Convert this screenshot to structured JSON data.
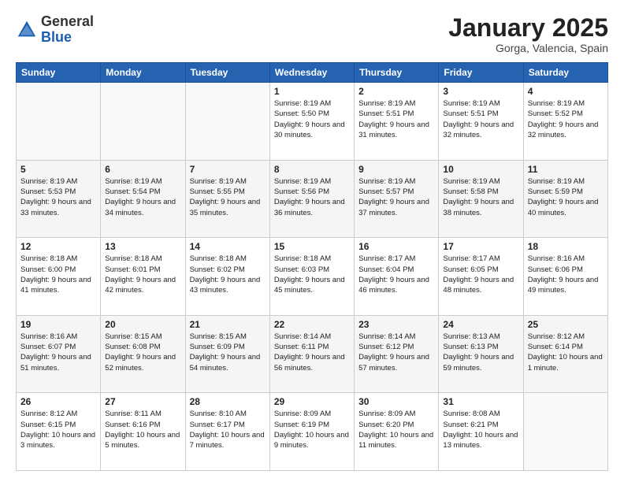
{
  "header": {
    "logo_general": "General",
    "logo_blue": "Blue",
    "month": "January 2025",
    "location": "Gorga, Valencia, Spain"
  },
  "weekdays": [
    "Sunday",
    "Monday",
    "Tuesday",
    "Wednesday",
    "Thursday",
    "Friday",
    "Saturday"
  ],
  "weeks": [
    [
      {
        "day": "",
        "info": ""
      },
      {
        "day": "",
        "info": ""
      },
      {
        "day": "",
        "info": ""
      },
      {
        "day": "1",
        "info": "Sunrise: 8:19 AM\nSunset: 5:50 PM\nDaylight: 9 hours\nand 30 minutes."
      },
      {
        "day": "2",
        "info": "Sunrise: 8:19 AM\nSunset: 5:51 PM\nDaylight: 9 hours\nand 31 minutes."
      },
      {
        "day": "3",
        "info": "Sunrise: 8:19 AM\nSunset: 5:51 PM\nDaylight: 9 hours\nand 32 minutes."
      },
      {
        "day": "4",
        "info": "Sunrise: 8:19 AM\nSunset: 5:52 PM\nDaylight: 9 hours\nand 32 minutes."
      }
    ],
    [
      {
        "day": "5",
        "info": "Sunrise: 8:19 AM\nSunset: 5:53 PM\nDaylight: 9 hours\nand 33 minutes."
      },
      {
        "day": "6",
        "info": "Sunrise: 8:19 AM\nSunset: 5:54 PM\nDaylight: 9 hours\nand 34 minutes."
      },
      {
        "day": "7",
        "info": "Sunrise: 8:19 AM\nSunset: 5:55 PM\nDaylight: 9 hours\nand 35 minutes."
      },
      {
        "day": "8",
        "info": "Sunrise: 8:19 AM\nSunset: 5:56 PM\nDaylight: 9 hours\nand 36 minutes."
      },
      {
        "day": "9",
        "info": "Sunrise: 8:19 AM\nSunset: 5:57 PM\nDaylight: 9 hours\nand 37 minutes."
      },
      {
        "day": "10",
        "info": "Sunrise: 8:19 AM\nSunset: 5:58 PM\nDaylight: 9 hours\nand 38 minutes."
      },
      {
        "day": "11",
        "info": "Sunrise: 8:19 AM\nSunset: 5:59 PM\nDaylight: 9 hours\nand 40 minutes."
      }
    ],
    [
      {
        "day": "12",
        "info": "Sunrise: 8:18 AM\nSunset: 6:00 PM\nDaylight: 9 hours\nand 41 minutes."
      },
      {
        "day": "13",
        "info": "Sunrise: 8:18 AM\nSunset: 6:01 PM\nDaylight: 9 hours\nand 42 minutes."
      },
      {
        "day": "14",
        "info": "Sunrise: 8:18 AM\nSunset: 6:02 PM\nDaylight: 9 hours\nand 43 minutes."
      },
      {
        "day": "15",
        "info": "Sunrise: 8:18 AM\nSunset: 6:03 PM\nDaylight: 9 hours\nand 45 minutes."
      },
      {
        "day": "16",
        "info": "Sunrise: 8:17 AM\nSunset: 6:04 PM\nDaylight: 9 hours\nand 46 minutes."
      },
      {
        "day": "17",
        "info": "Sunrise: 8:17 AM\nSunset: 6:05 PM\nDaylight: 9 hours\nand 48 minutes."
      },
      {
        "day": "18",
        "info": "Sunrise: 8:16 AM\nSunset: 6:06 PM\nDaylight: 9 hours\nand 49 minutes."
      }
    ],
    [
      {
        "day": "19",
        "info": "Sunrise: 8:16 AM\nSunset: 6:07 PM\nDaylight: 9 hours\nand 51 minutes."
      },
      {
        "day": "20",
        "info": "Sunrise: 8:15 AM\nSunset: 6:08 PM\nDaylight: 9 hours\nand 52 minutes."
      },
      {
        "day": "21",
        "info": "Sunrise: 8:15 AM\nSunset: 6:09 PM\nDaylight: 9 hours\nand 54 minutes."
      },
      {
        "day": "22",
        "info": "Sunrise: 8:14 AM\nSunset: 6:11 PM\nDaylight: 9 hours\nand 56 minutes."
      },
      {
        "day": "23",
        "info": "Sunrise: 8:14 AM\nSunset: 6:12 PM\nDaylight: 9 hours\nand 57 minutes."
      },
      {
        "day": "24",
        "info": "Sunrise: 8:13 AM\nSunset: 6:13 PM\nDaylight: 9 hours\nand 59 minutes."
      },
      {
        "day": "25",
        "info": "Sunrise: 8:12 AM\nSunset: 6:14 PM\nDaylight: 10 hours\nand 1 minute."
      }
    ],
    [
      {
        "day": "26",
        "info": "Sunrise: 8:12 AM\nSunset: 6:15 PM\nDaylight: 10 hours\nand 3 minutes."
      },
      {
        "day": "27",
        "info": "Sunrise: 8:11 AM\nSunset: 6:16 PM\nDaylight: 10 hours\nand 5 minutes."
      },
      {
        "day": "28",
        "info": "Sunrise: 8:10 AM\nSunset: 6:17 PM\nDaylight: 10 hours\nand 7 minutes."
      },
      {
        "day": "29",
        "info": "Sunrise: 8:09 AM\nSunset: 6:19 PM\nDaylight: 10 hours\nand 9 minutes."
      },
      {
        "day": "30",
        "info": "Sunrise: 8:09 AM\nSunset: 6:20 PM\nDaylight: 10 hours\nand 11 minutes."
      },
      {
        "day": "31",
        "info": "Sunrise: 8:08 AM\nSunset: 6:21 PM\nDaylight: 10 hours\nand 13 minutes."
      },
      {
        "day": "",
        "info": ""
      }
    ]
  ]
}
